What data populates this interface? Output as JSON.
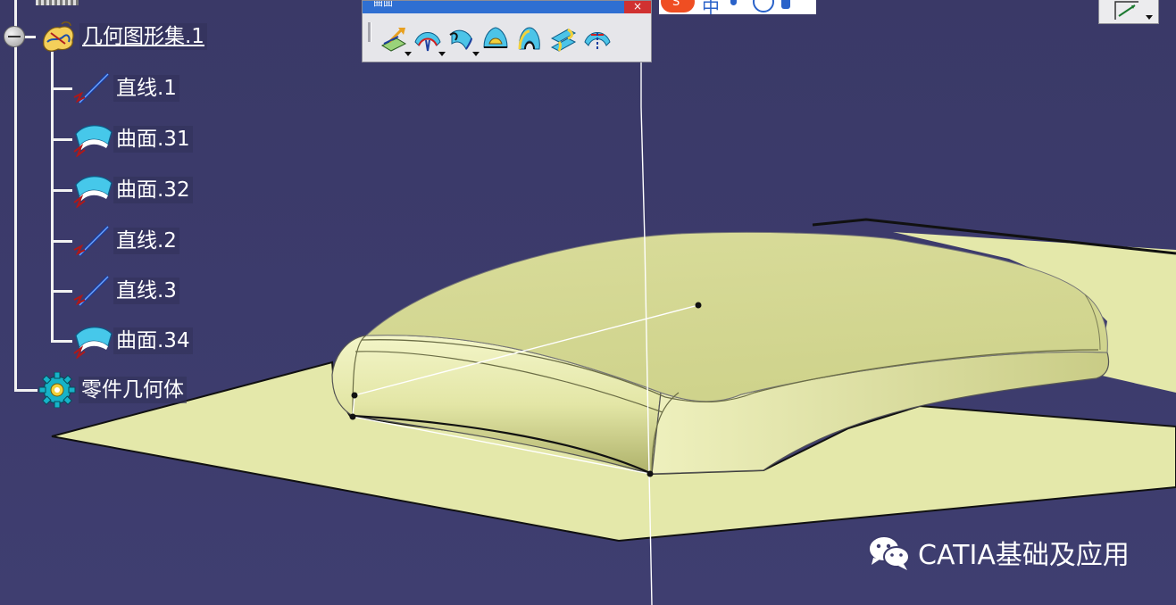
{
  "toolbar": {
    "title": "曲面",
    "close_glyph": "×",
    "tools": [
      {
        "icon": "extrude-surface-icon",
        "has_dropdown": true
      },
      {
        "icon": "offset-surface-icon",
        "has_dropdown": true
      },
      {
        "icon": "sweep-surface-icon",
        "has_dropdown": true
      },
      {
        "icon": "fill-surface-icon",
        "has_dropdown": false
      },
      {
        "icon": "multi-section-surface-icon",
        "has_dropdown": false
      },
      {
        "icon": "blend-surface-icon",
        "has_dropdown": false
      },
      {
        "icon": "revolve-surface-icon",
        "has_dropdown": false
      }
    ]
  },
  "ime": {
    "logo": "S",
    "mode": "中"
  },
  "tree": {
    "geometric_set": {
      "label": "几何图形集.1",
      "icon": "geometrical-set-icon"
    },
    "items": [
      {
        "label": "直线.1",
        "icon": "line-icon"
      },
      {
        "label": "曲面.31",
        "icon": "surface-icon"
      },
      {
        "label": "曲面.32",
        "icon": "surface-icon"
      },
      {
        "label": "直线.2",
        "icon": "line-icon"
      },
      {
        "label": "直线.3",
        "icon": "line-icon"
      },
      {
        "label": "曲面.34",
        "icon": "surface-icon"
      }
    ],
    "part_body": {
      "label": "零件几何体",
      "icon": "part-body-gear-icon"
    }
  },
  "watermark": {
    "text": "CATIA基础及应用",
    "icon": "wechat-icon"
  },
  "colors": {
    "background": "#3c3b6c",
    "surface": "#e3e7a6",
    "tree_text": "#ffffff",
    "toolbar_title": "#2f6fd2"
  }
}
